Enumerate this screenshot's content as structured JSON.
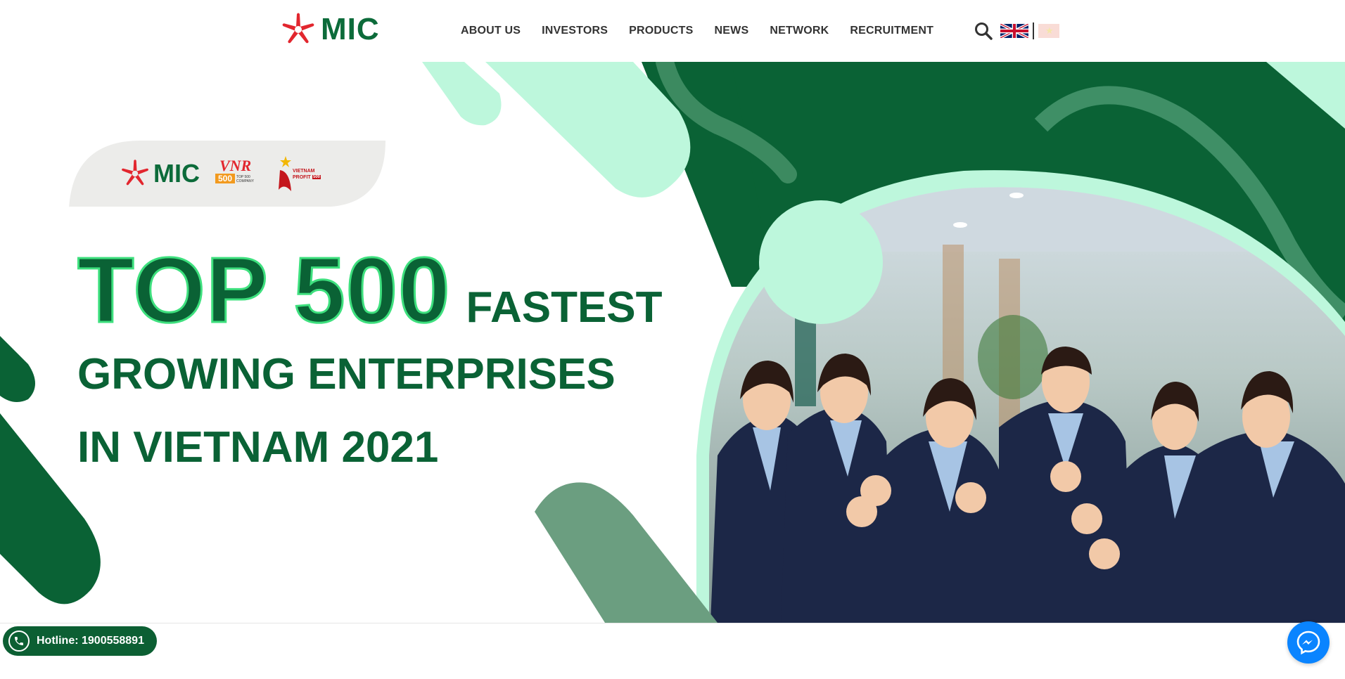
{
  "brand": {
    "logo_text": "MIC",
    "primary_color": "#0c6b3a",
    "accent_color": "#e2262e",
    "mint_color": "#bdf7dc"
  },
  "nav": {
    "items": [
      {
        "label": "ABOUT US"
      },
      {
        "label": "INVESTORS"
      },
      {
        "label": "PRODUCTS"
      },
      {
        "label": "NEWS"
      },
      {
        "label": "NETWORK"
      },
      {
        "label": "RECRUITMENT"
      }
    ],
    "search_icon": "search-icon",
    "languages": [
      "flag-uk-icon",
      "flag-vn-icon"
    ]
  },
  "banner": {
    "badge_logo_text": "MIC",
    "vnr_text": "VNR",
    "vnr_number": "500",
    "vnr_sub": "TOP 500 COMPANY",
    "profit_text": "VIETNAM",
    "profit_line2": "PROFIT",
    "profit_badge": "500",
    "headline_big": "TOP 500",
    "headline_small": "FASTEST",
    "headline_line2": "GROWING ENTERPRISES",
    "headline_line3": "IN VIETNAM 2021"
  },
  "hotline": {
    "label": "Hotline: 1900558891",
    "icon": "phone-icon"
  },
  "messenger": {
    "icon": "messenger-icon",
    "color": "#0a84ff"
  }
}
